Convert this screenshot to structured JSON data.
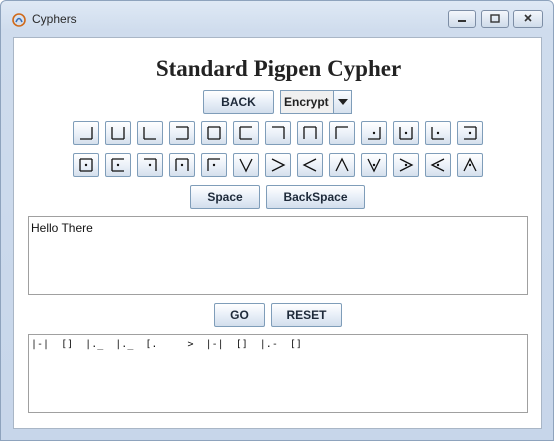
{
  "window": {
    "title": "Cyphers",
    "controls": [
      "minimize",
      "maximize",
      "close"
    ]
  },
  "heading": "Standard Pigpen Cypher",
  "toolbar": {
    "back_label": "BACK",
    "mode_selected": "Encrypt"
  },
  "keyboard": {
    "row1": [
      {
        "glyph": "grid-br"
      },
      {
        "glyph": "grid-b"
      },
      {
        "glyph": "grid-bl"
      },
      {
        "glyph": "grid-r"
      },
      {
        "glyph": "grid-c"
      },
      {
        "glyph": "grid-l"
      },
      {
        "glyph": "grid-tr"
      },
      {
        "glyph": "grid-t"
      },
      {
        "glyph": "grid-tl"
      },
      {
        "glyph": "grid-br-dot"
      },
      {
        "glyph": "grid-b-dot"
      },
      {
        "glyph": "grid-bl-dot"
      },
      {
        "glyph": "grid-r-dot"
      }
    ],
    "row2": [
      {
        "glyph": "grid-c-dot"
      },
      {
        "glyph": "grid-l-dot"
      },
      {
        "glyph": "grid-tr-dot"
      },
      {
        "glyph": "grid-t-dot"
      },
      {
        "glyph": "grid-tl-dot"
      },
      {
        "glyph": "x-v"
      },
      {
        "glyph": "x-gt"
      },
      {
        "glyph": "x-lt"
      },
      {
        "glyph": "x-caret"
      },
      {
        "glyph": "x-v-dot"
      },
      {
        "glyph": "x-gt-dot"
      },
      {
        "glyph": "x-lt-dot"
      },
      {
        "glyph": "x-caret-dot"
      }
    ],
    "space_label": "Space",
    "backspace_label": "BackSpace"
  },
  "input": {
    "value": "Hello There"
  },
  "actions": {
    "go_label": "GO",
    "reset_label": "RESET"
  },
  "output": {
    "value": "|-|  []  |._  |._  [.     >  |-|  []  |.-  []"
  }
}
